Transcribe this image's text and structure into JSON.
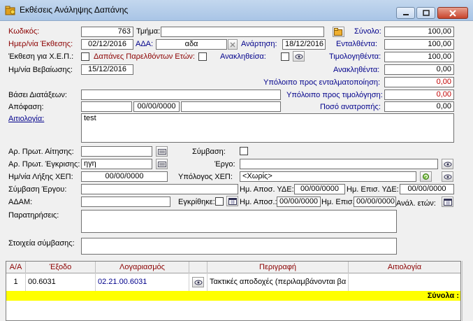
{
  "window": {
    "title": "Εκθέσεις Ανάληψης Δαπάνης",
    "min_symbol": "▁",
    "max_symbol": "▢",
    "close_symbol": "✕"
  },
  "form": {
    "code_label": "Κωδικός:",
    "code_value": "763",
    "department_label": "Τμήμα:",
    "department_value": "",
    "date_label": "Ημερ/νία Έκθεσης:",
    "date_value": "02/12/2016",
    "ada_label": "ΑΔΑ:",
    "ada_value": "αδα",
    "posting_label": "Ανάρτηση:",
    "posting_value": "18/12/2016",
    "xep_label": "Έκθεση για Χ.Ε.Π.:",
    "past_years_label": "Δαπάνες Παρελθόντων Ετών:",
    "revoked_label": "Ανακληθείσα:",
    "verification_label": "Ημ/νία Βεβαίωσης:",
    "verification_value": "15/12/2016",
    "legal_label": "Βάσει Διατάξεων:",
    "legal_value": "",
    "decision_label": "Απόφαση:",
    "decision_value1": "",
    "decision_date": "00/00/0000",
    "decision_value2": "",
    "justification_label": "Αιτιολογία:",
    "justification_value": "test",
    "request_protocol_label": "Αρ. Πρωτ. Αίτησης:",
    "request_protocol_value": "",
    "approval_protocol_label": "Αρ. Πρωτ. Έγκρισης:",
    "approval_protocol_value": "ηγη",
    "xep_expiry_label": "Ημ/νία Λήξης ΧΕΠ:",
    "xep_expiry_value": "00/00/0000",
    "contract_label": "Σύμβαση:",
    "project_label": "Έργο:",
    "project_value": "",
    "xep_responsible_label": "Υπόλογος ΧΕΠ:",
    "xep_responsible_value": "<Χωρίς>",
    "project_contract_label": "Σύμβαση Έργου:",
    "project_contract_value": "",
    "ude_dispatch_label": "Ημ. Αποσ. ΥΔΕ:",
    "ude_dispatch_value": "00/00/0000",
    "ude_return_label": "Ημ. Επισ. ΥΔΕ:",
    "ude_return_value": "00/00/0000",
    "adam_label": "ΑΔΑΜ:",
    "adam_value": "",
    "approved_label": "Εγκρίθηκε:",
    "dispatch_label": "Ημ. Αποσ.:",
    "dispatch_value": "00/00/0000",
    "return_label": "Ημ. Επισ.:",
    "return_value": "00/00/0000",
    "years_analysis_label": "Ανάλ. ετών:",
    "notes_label": "Παρατηρήσεις:",
    "notes_value": "",
    "contract_details_label": "Στοιχεία σύμβασης:",
    "contract_details_value": ""
  },
  "totals": {
    "total_label": "Σύνολο:",
    "total_value": "100,00",
    "committed_label": "Ενταλθέντα:",
    "committed_value": "100,00",
    "invoiced_label": "Τιμολογηθέντα:",
    "invoiced_value": "100,00",
    "recalled_label": "Ανακληθέντα:",
    "recalled_value": "0,00",
    "remaining_commit_label": "Υπόλοιπο προς ενταλματοποίηση:",
    "remaining_commit_value": "0,00",
    "remaining_invoice_label": "Υπόλοιπο προς τιμολόγηση:",
    "remaining_invoice_value": "0,00",
    "reversal_label": "Ποσό ανατροπής:",
    "reversal_value": "0,00"
  },
  "grid": {
    "headers": [
      "Α/Α",
      "Έξοδο",
      "Λογαριασμός",
      "",
      "Περιγραφή",
      "Αιτιολογία"
    ],
    "row": {
      "aa": "1",
      "expense": "00.6031",
      "account": "02.21.00.6031",
      "description": "Τακτικές αποδοχές (περιλαμβάνονται βα",
      "justification": ""
    },
    "totals_label": "Σύνολα :"
  },
  "colors": {
    "label_red": "#8b0000",
    "label_blue": "#00008b",
    "totals_row": "#ffff00"
  }
}
